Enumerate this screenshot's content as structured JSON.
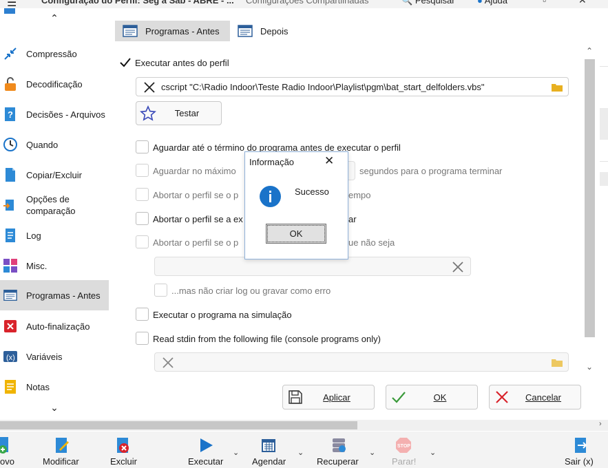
{
  "titlebar": {
    "title": "Configuração do Perfil: Seg a Sab - ABRE - ...",
    "title2": "Configurações Compartilhadas",
    "search": "Pesquisar",
    "help": "Ajuda"
  },
  "sidebar": {
    "items": [
      {
        "label": "Compressão",
        "icon": "compress-icon"
      },
      {
        "label": "Decodificação",
        "icon": "lock-icon"
      },
      {
        "label": "Decisões - Arquivos",
        "icon": "question-file-icon"
      },
      {
        "label": "Quando",
        "icon": "clock-icon"
      },
      {
        "label": "Copiar/Excluir",
        "icon": "file-icon"
      },
      {
        "label": "Opções de comparação",
        "icon": "compare-icon"
      },
      {
        "label": "Log",
        "icon": "log-icon"
      },
      {
        "label": "Misc.",
        "icon": "misc-icon"
      },
      {
        "label": "Programas - Antes",
        "icon": "program-icon",
        "selected": true
      },
      {
        "label": "Auto-finalização",
        "icon": "close-red-icon"
      },
      {
        "label": "Variáveis",
        "icon": "variables-icon"
      },
      {
        "label": "Notas",
        "icon": "notes-icon"
      }
    ]
  },
  "tabs": [
    {
      "label": "Programas - Antes",
      "active": true
    },
    {
      "label": "Depois",
      "active": false
    }
  ],
  "form": {
    "run_before_label": "Executar antes do perfil",
    "run_before_checked": true,
    "command_value": "cscript \"C:\\Radio Indoor\\Teste Radio Indoor\\Playlist\\pgm\\bat_start_delfolders.vbs\"",
    "test_button": "Testar",
    "wait_end_label": "Aguardar até o término do programa antes de executar o perfil",
    "wait_max_label": "Aguardar no máximo",
    "wait_seconds_label": "segundos para o programa terminar",
    "abort_timeout_label_left": "Abortar o perfil se o p",
    "abort_timeout_label_right": "empo",
    "abort_exec_label_left": "Abortar o perfil se a ex",
    "abort_exec_label_right": "ar",
    "abort_return_label_left": "Abortar o perfil se o p",
    "abort_return_label_right": "ue não seja",
    "no_log_label": "...mas não criar log ou gravar como erro",
    "run_simulation_label": "Executar o programa na simulação",
    "read_stdin_label": "Read stdin from the following file (console programs only)"
  },
  "actions": {
    "apply": "Aplicar",
    "ok": "OK",
    "cancel": "Cancelar"
  },
  "dialog": {
    "title": "Informação",
    "message": "Sucesso",
    "ok": "OK"
  },
  "toolbar": {
    "items": [
      {
        "label": "ovo"
      },
      {
        "label": "Modificar"
      },
      {
        "label": "Excluir"
      },
      {
        "label": "Executar"
      },
      {
        "label": "Agendar"
      },
      {
        "label": "Recuperar"
      },
      {
        "label": "Parar!",
        "disabled": true
      },
      {
        "label": "Sair (x)"
      }
    ]
  },
  "colors": {
    "accent_blue": "#1a73c9",
    "selected_bg": "#dcdcdc",
    "cancel_red": "#d9232b",
    "ok_green": "#3a9a3a",
    "folder_yellow": "#e8b020"
  }
}
